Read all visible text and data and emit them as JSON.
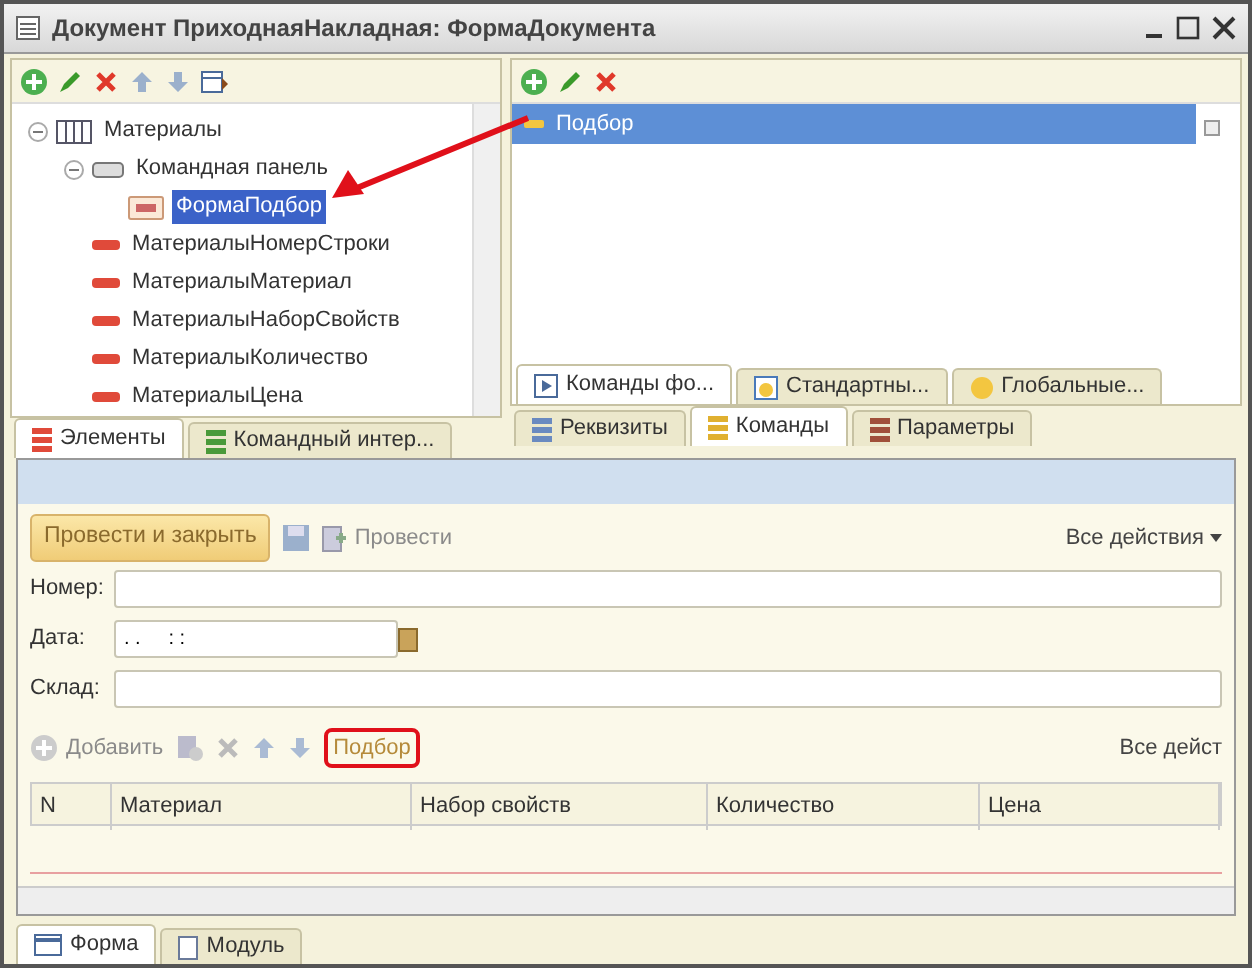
{
  "window": {
    "title": "Документ ПриходнаяНакладная: ФормаДокумента"
  },
  "elements_panel": {
    "tree": [
      {
        "label": "Материалы",
        "kind": "table",
        "expanded": true,
        "selected": false,
        "children": [
          {
            "label": "Командная панель",
            "kind": "command-bar",
            "expanded": true,
            "selected": false,
            "children": [
              {
                "label": "ФормаПодбор",
                "kind": "button",
                "selected": true
              }
            ]
          },
          {
            "label": "МатериалыНомерСтроки",
            "kind": "field",
            "selected": false
          },
          {
            "label": "МатериалыМатериал",
            "kind": "field",
            "selected": false
          },
          {
            "label": "МатериалыНаборСвойств",
            "kind": "field",
            "selected": false
          },
          {
            "label": "МатериалыКоличество",
            "kind": "field",
            "selected": false
          },
          {
            "label": "МатериалыЦена",
            "kind": "field",
            "selected": false
          }
        ]
      }
    ],
    "tabs": [
      {
        "label": "Элементы",
        "selected": true
      },
      {
        "label": "Командный интер...",
        "selected": false
      }
    ]
  },
  "commands_panel": {
    "list": [
      {
        "label": "Подбор",
        "selected": true
      }
    ],
    "inner_tabs": [
      {
        "label": "Команды фо...",
        "selected": true
      },
      {
        "label": "Стандартны...",
        "selected": false
      },
      {
        "label": "Глобальные...",
        "selected": false
      }
    ],
    "tabs": [
      {
        "label": "Реквизиты",
        "selected": false
      },
      {
        "label": "Команды",
        "selected": true
      },
      {
        "label": "Параметры",
        "selected": false
      }
    ]
  },
  "form_preview": {
    "post_close_button": "Провести и закрыть",
    "post_button": "Провести",
    "all_actions": "Все действия",
    "fields": [
      {
        "label": "Номер:"
      },
      {
        "label": "Дата:",
        "value": ". .     : :",
        "kind": "date"
      },
      {
        "label": "Склад:"
      }
    ],
    "table_toolbar": {
      "add_button": "Добавить",
      "pick_button": {
        "label": "Подбор",
        "highlighted": true
      },
      "all_actions": "Все дейст"
    },
    "table": {
      "columns": [
        "N",
        "Материал",
        "Набор свойств",
        "Количество",
        "Цена"
      ]
    }
  },
  "bottom_tabs": [
    {
      "label": "Форма",
      "selected": true
    },
    {
      "label": "Модуль",
      "selected": false
    }
  ]
}
